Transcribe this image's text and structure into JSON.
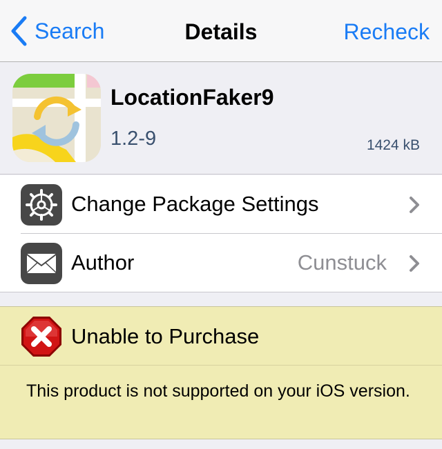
{
  "nav": {
    "back_label": "Search",
    "title": "Details",
    "action_label": "Recheck"
  },
  "package": {
    "name": "LocationFaker9",
    "version": "1.2-9",
    "size": "1424 kB"
  },
  "menu": {
    "items": [
      {
        "label": "Change Package Settings",
        "value": "",
        "icon": "gear-icon"
      },
      {
        "label": "Author",
        "value": "Cunstuck",
        "icon": "envelope-icon"
      }
    ]
  },
  "warning": {
    "title": "Unable to Purchase",
    "message": "This product is not supported on your iOS version.",
    "icon": "error-x-icon"
  },
  "colors": {
    "accent": "#1a7cf5",
    "warning_bg": "#f0ecb4",
    "version_text": "#39506e"
  }
}
